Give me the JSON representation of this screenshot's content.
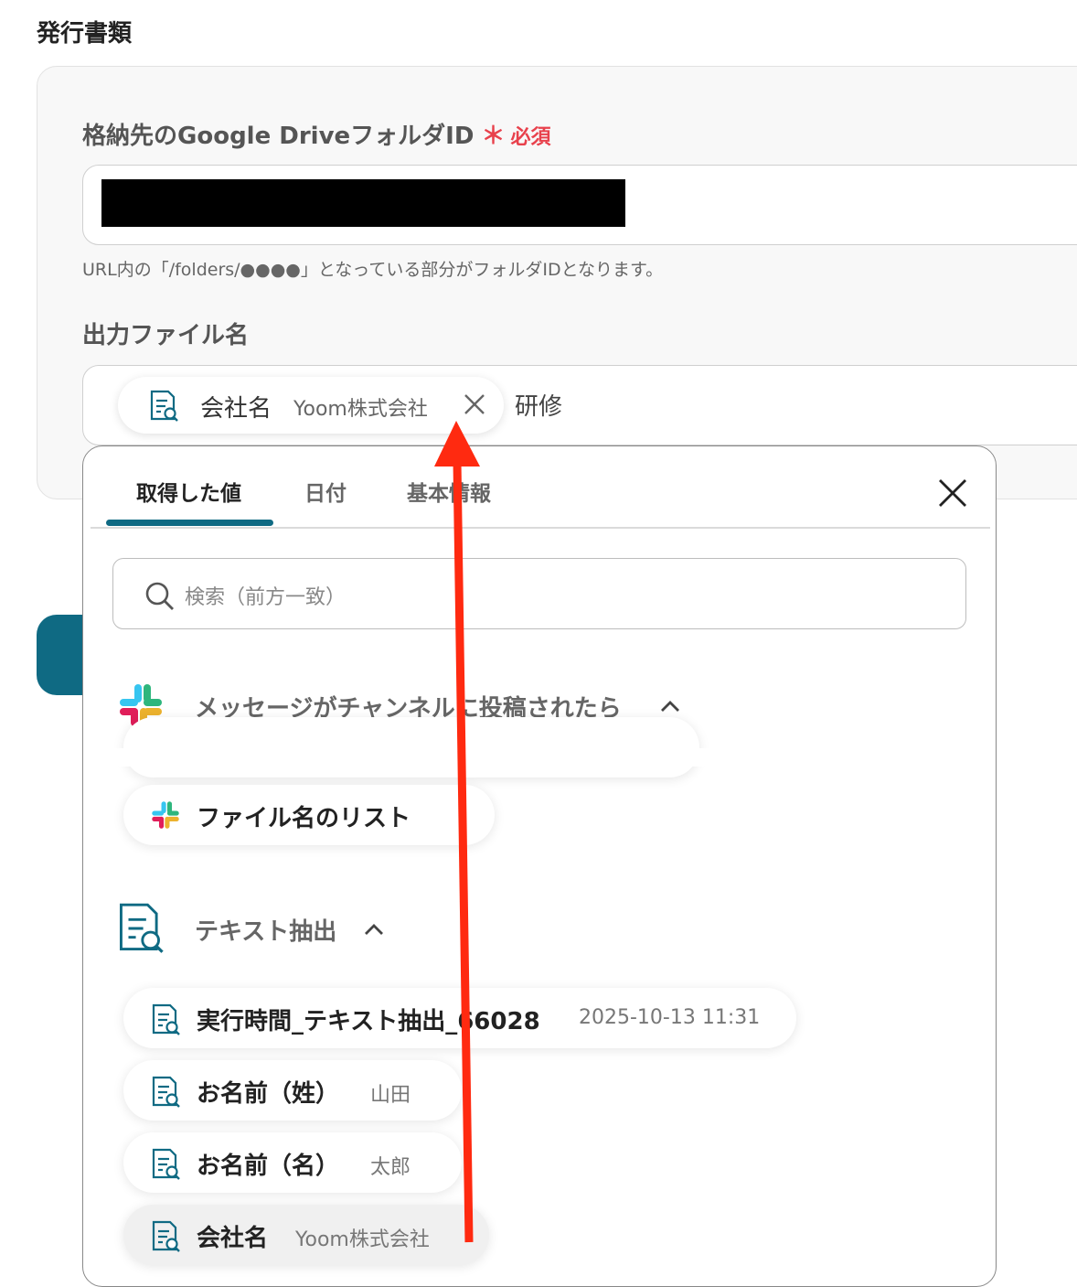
{
  "section_title": "発行書類",
  "folder_field": {
    "label": "格納先のGoogle DriveフォルダID",
    "required_mark": "＊",
    "required_text": "必須",
    "hint": "URL内の「/folders/●●●●」となっている部分がフォルダIDとなります。"
  },
  "filename_field": {
    "label": "出力ファイル名",
    "chip": {
      "name": "会社名",
      "value": "Yoom株式会社"
    },
    "trailing_text": "研修"
  },
  "popup": {
    "tabs": [
      {
        "label": "取得した値",
        "active": true
      },
      {
        "label": "日付",
        "active": false
      },
      {
        "label": "基本情報",
        "active": false
      }
    ],
    "search_placeholder": "検索（前方一致）",
    "groups": [
      {
        "title": "メッセージがチャンネルに投稿されたら",
        "icon": "slack-icon",
        "items": [
          {
            "name": "ファイル名のリスト",
            "value": ""
          }
        ]
      },
      {
        "title": "テキスト抽出",
        "icon": "document-search-icon",
        "items": [
          {
            "name": "実行時間_テキスト抽出_66028",
            "value": "2025-10-13 11:31"
          },
          {
            "name": "お名前（姓）",
            "value": "山田"
          },
          {
            "name": "お名前（名）",
            "value": "太郎"
          },
          {
            "name": "会社名",
            "value": "Yoom株式会社"
          }
        ]
      }
    ]
  },
  "colors": {
    "accent": "#0f6a83",
    "required": "#e8414c",
    "annotation_arrow": "#ff2a10"
  }
}
